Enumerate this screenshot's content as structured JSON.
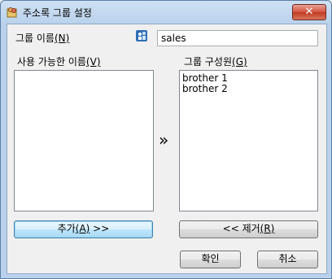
{
  "window": {
    "title": "주소록 그룹 설정",
    "close_glyph": "✕"
  },
  "group_name": {
    "label": "그룹 이름",
    "mnemonic": "(N)",
    "value": "sales"
  },
  "available": {
    "label": "사용 가능한 이름",
    "mnemonic": "(V)",
    "items": []
  },
  "members": {
    "label": "그룹 구성원",
    "mnemonic": "(G)",
    "items": [
      "brother 1",
      "brother 2"
    ]
  },
  "transfer_glyph": "»",
  "buttons": {
    "add_prefix": "추가",
    "add_mnemonic": "(A)",
    "add_suffix": " >>",
    "remove_prefix": "<< 제거",
    "remove_mnemonic": "(R)",
    "ok": "확인",
    "cancel": "취소"
  },
  "colors": {
    "accent": "#3c7fb1",
    "close": "#c03a22"
  }
}
